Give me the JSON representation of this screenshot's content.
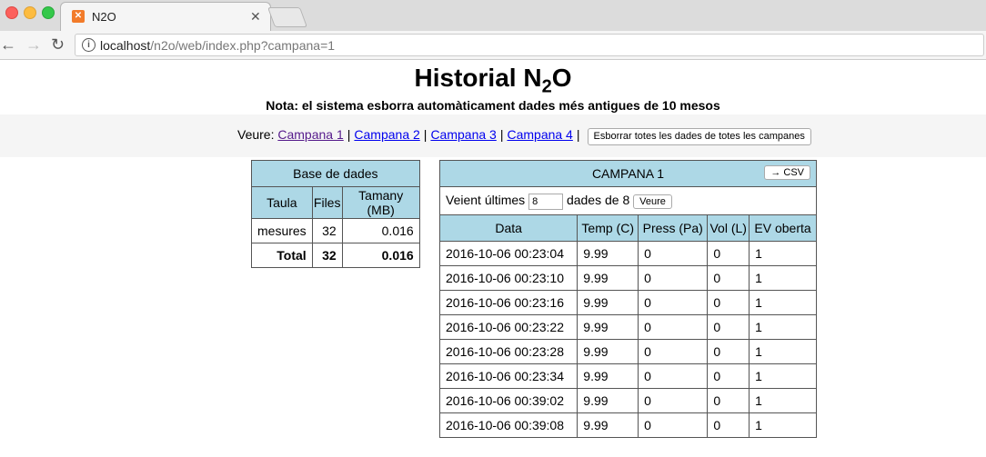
{
  "browser": {
    "tab_title": "N2O",
    "url_host": "localhost",
    "url_path": "/n2o/web/index.php?campana=1"
  },
  "page": {
    "title": "Historial N",
    "title_sub": "2",
    "title_end": "O",
    "note": "Nota: el sistema esborra automàticament dades més antigues de 10 mesos",
    "nav_label": "Veure:",
    "campaigns": [
      "Campana 1",
      "Campana 2",
      "Campana 3",
      "Campana 4"
    ],
    "delete_all_label": "Esborrar totes les dades de totes les campanes"
  },
  "db_table": {
    "title": "Base de dades",
    "headers": [
      "Taula",
      "Files",
      "Tamany (MB)"
    ],
    "rows": [
      [
        "mesures",
        "32",
        "0.016"
      ]
    ],
    "total": [
      "Total",
      "32",
      "0.016"
    ]
  },
  "campaign_table": {
    "title": "CAMPANA 1",
    "csv_label": "→ CSV",
    "showing_label": "Veient últimes",
    "count_value": "8",
    "of_label": "dades de 8",
    "view_label": "Veure",
    "headers": [
      "Data",
      "Temp (C)",
      "Press (Pa)",
      "Vol (L)",
      "EV oberta"
    ],
    "rows": [
      [
        "2016-10-06 00:23:04",
        "9.99",
        "0",
        "0",
        "1"
      ],
      [
        "2016-10-06 00:23:10",
        "9.99",
        "0",
        "0",
        "1"
      ],
      [
        "2016-10-06 00:23:16",
        "9.99",
        "0",
        "0",
        "1"
      ],
      [
        "2016-10-06 00:23:22",
        "9.99",
        "0",
        "0",
        "1"
      ],
      [
        "2016-10-06 00:23:28",
        "9.99",
        "0",
        "0",
        "1"
      ],
      [
        "2016-10-06 00:23:34",
        "9.99",
        "0",
        "0",
        "1"
      ],
      [
        "2016-10-06 00:39:02",
        "9.99",
        "0",
        "0",
        "1"
      ],
      [
        "2016-10-06 00:39:08",
        "9.99",
        "0",
        "0",
        "1"
      ]
    ]
  },
  "colors": {
    "header_bg": "#add8e6",
    "link": "#0000ee",
    "visited": "#551a8b"
  }
}
